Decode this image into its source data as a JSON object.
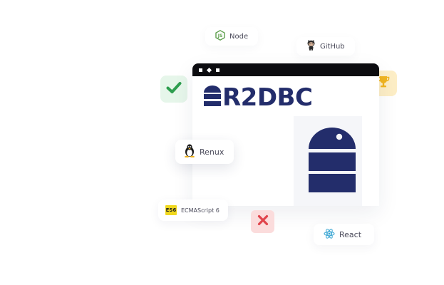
{
  "badges": {
    "node": "Node",
    "github": "GitHub",
    "renux": "Renux",
    "es6_icon": "ES6",
    "ecmascript": "ECMAScript 6",
    "react": "React"
  },
  "window": {
    "logo_text": "R2DBC"
  },
  "colors": {
    "brand_navy": "#232d6b",
    "check_green": "#2e9e4f",
    "cross_red": "#e0434b",
    "trophy_gold": "#f1b520",
    "node_green": "#5fa04e",
    "react_blue": "#3aa6d3",
    "es6_yellow": "#f0d81e"
  },
  "icons": {
    "node": "nodejs-icon",
    "github": "github-octocat-icon",
    "renux": "linux-tux-icon",
    "es6": "es6-icon",
    "react": "react-icon",
    "check": "checkmark-icon",
    "trophy": "trophy-icon",
    "cross": "close-icon",
    "database": "database-icon"
  }
}
